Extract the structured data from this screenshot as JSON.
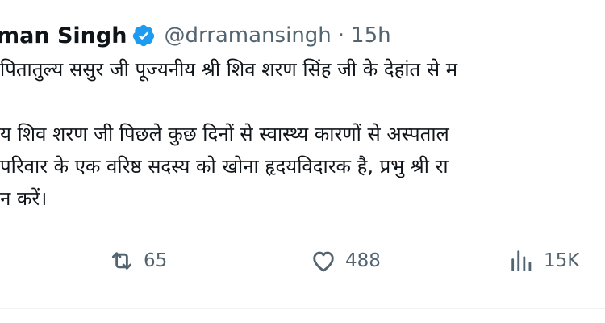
{
  "tweet": {
    "author_name": "man Singh",
    "handle": "@drramansingh",
    "separator": "·",
    "time": "15h",
    "lines": [
      "पितातुल्य ससुर जी पूज्यनीय श्री शिव शरण सिंह जी के देहांत से म",
      "",
      "य शिव शरण जी पिछले कुछ दिनों से स्वास्थ्य कारणों से अस्पताल",
      "परिवार के एक वरिष्ठ सदस्य को खोना हृदयविदारक है, प्रभु श्री रा",
      "न करें।"
    ]
  },
  "actions": {
    "retweets": "65",
    "likes": "488",
    "views": "15K"
  },
  "colors": {
    "verified": "#1d9bf0",
    "secondary_text": "#536471",
    "primary_text": "#0f1419"
  }
}
